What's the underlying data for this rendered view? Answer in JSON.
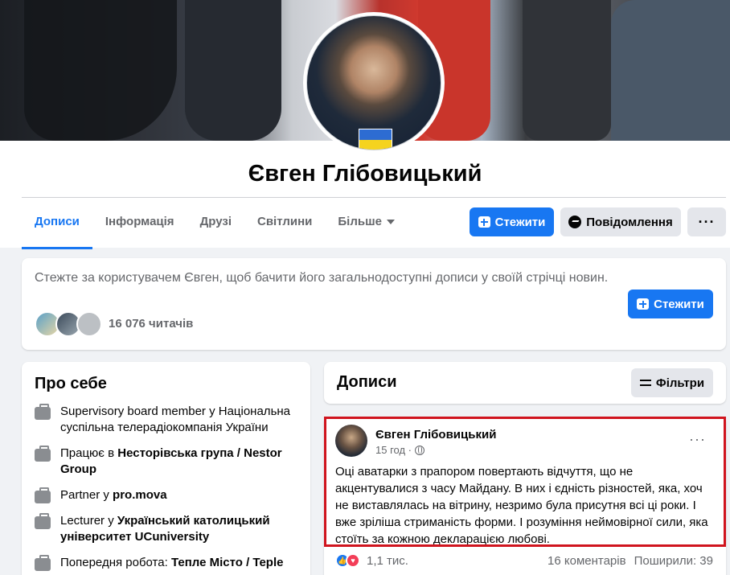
{
  "profile": {
    "name": "Євген Глібовицький"
  },
  "nav": {
    "tabs": [
      {
        "label": "Дописи"
      },
      {
        "label": "Інформація"
      },
      {
        "label": "Друзі"
      },
      {
        "label": "Світлини"
      },
      {
        "label": "Більше"
      }
    ]
  },
  "actions": {
    "follow": "Стежити",
    "message": "Повідомлення",
    "more": "···"
  },
  "follow_card": {
    "text": "Стежте за користувачем Євген, щоб бачити його загальнодоступні дописи у своїй стрічці новин.",
    "followers": "16 076 читачів",
    "button": "Стежити"
  },
  "about": {
    "title": "Про себе",
    "items": [
      {
        "prefix": "Supervisory board member у Національна суспільна телерадіокомпанія України",
        "bold": ""
      },
      {
        "prefix": "Працює в ",
        "bold": "Несторівська група / Nestor Group"
      },
      {
        "prefix": "Partner у ",
        "bold": "pro.mova"
      },
      {
        "prefix": "Lecturer у ",
        "bold": "Український католицький університет UCuniversity"
      },
      {
        "prefix": "Попередня робота: ",
        "bold": "Тепле Місто / Teple"
      }
    ]
  },
  "posts": {
    "title": "Дописи",
    "filters": "Фільтри"
  },
  "post": {
    "author": "Євген Глібовицький",
    "time": "15 год ·",
    "more": "···",
    "text": "Оці аватарки з прапором повертають відчуття, що не акцентувалися з часу Майдану. В них і єдність різностей, яка, хоч не виставлялась на вітрину, незримо була присутня всі ці роки. І вже зріліша стриманість форми. І розуміння неймовірної сили, яка стоїть за кожною декларацією любові.",
    "reactions": "1,1 тис.",
    "comments": "16 коментарів",
    "shares": "Поширили: 39"
  },
  "colors": {
    "accent": "#1877f2",
    "highlight": "#d0141e",
    "flag_blue": "#2d6cd2",
    "flag_yellow": "#f5d31f"
  }
}
